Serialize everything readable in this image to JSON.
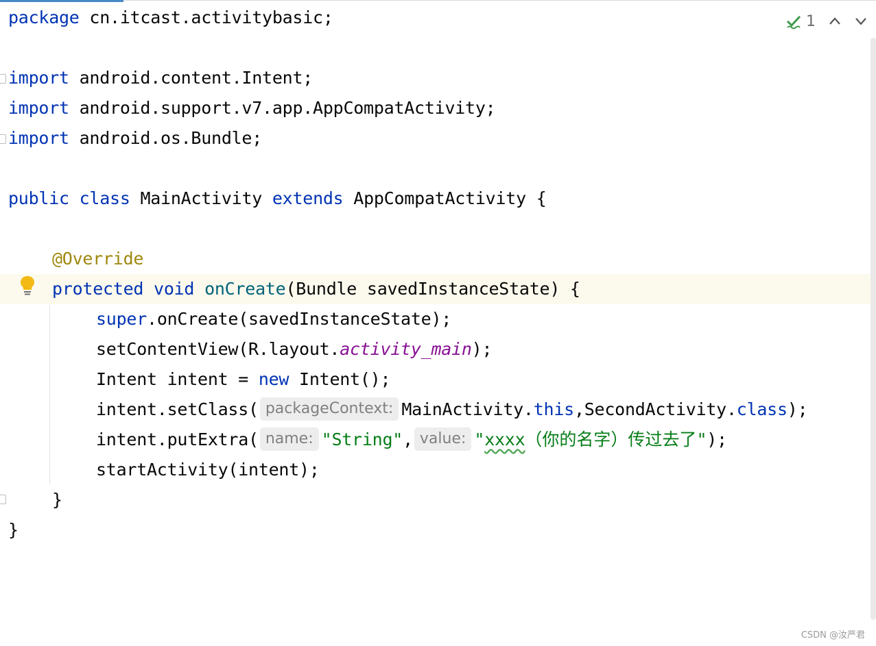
{
  "status": {
    "check_icon": "check-icon",
    "count": "1",
    "up_icon": "chevron-up-icon",
    "down_icon": "chevron-down-icon"
  },
  "code": {
    "l1": {
      "kw": "package",
      "rest": " cn.itcast.activitybasic;"
    },
    "l3": {
      "kw": "import",
      "rest": " android.content.Intent;"
    },
    "l4": {
      "kw": "import",
      "rest": " android.support.v7.app.AppCompatActivity;"
    },
    "l5": {
      "kw": "import",
      "rest": " android.os.Bundle;"
    },
    "l7": {
      "kw1": "public",
      "kw2": "class",
      "name": " MainActivity ",
      "kw3": "extends",
      "rest": " AppCompatActivity {"
    },
    "l9": {
      "ann": "@Override"
    },
    "l10": {
      "kw1": "protected",
      "kw2": "void",
      "fn": "onCreate",
      "rest": "(Bundle savedInstanceState) {"
    },
    "l11": {
      "kw": "super",
      "rest": ".onCreate(savedInstanceState);"
    },
    "l12": {
      "pre": "setContentView(R.layout.",
      "ital": "activity_main",
      "post": ");"
    },
    "l13": {
      "pre": "Intent intent = ",
      "kw": "new",
      "post": " Intent();"
    },
    "l14": {
      "pre": "intent.setClass(",
      "hint": "packageContext:",
      "mid": "MainActivity.",
      "kw1": "this",
      "mid2": ",SecondActivity.",
      "kw2": "class",
      "post": ");"
    },
    "l15": {
      "pre": "intent.putExtra(",
      "hint1": "name:",
      "str1": "\"String\"",
      "comma": ",",
      "hint2": "value:",
      "q1": "\"",
      "xs": "xxxx",
      "cjk": "（你的名字）传过去了",
      "q2": "\"",
      "post": ");"
    },
    "l16": {
      "text": "startActivity(intent);"
    },
    "l17": {
      "text": "}"
    },
    "l18": {
      "text": "}"
    }
  },
  "watermark": "CSDN @汝严君"
}
